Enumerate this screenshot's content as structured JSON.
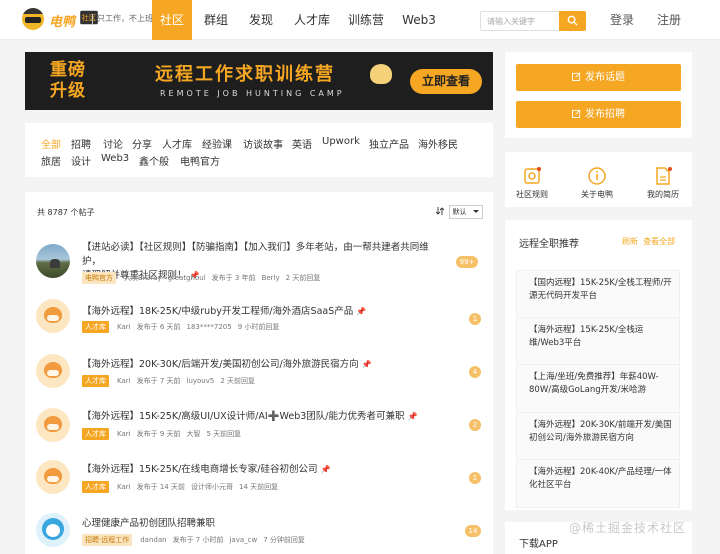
{
  "brand": {
    "name": "电鸭",
    "tag": "社区",
    "slogan": "只工作，不上班"
  },
  "nav": [
    {
      "label": "社区",
      "active": true
    },
    {
      "label": "群组",
      "active": false
    },
    {
      "label": "发现",
      "active": false
    },
    {
      "label": "人才库",
      "active": false
    },
    {
      "label": "训练营",
      "active": false
    },
    {
      "label": "Web3",
      "active": false
    }
  ],
  "search": {
    "placeholder": "请输入关键字"
  },
  "auth": {
    "login": "登录",
    "register": "注册"
  },
  "banner": {
    "left_line1": "重磅",
    "left_line2": "升级",
    "title": "远程工作求职训练营",
    "subtitle": "REMOTE JOB HUNTING CAMP",
    "cta": "立即查看"
  },
  "tags": [
    "全部",
    "招聘",
    "讨论",
    "分享",
    "人才库",
    "经验课",
    "访谈故事",
    "英语",
    "Upwork",
    "独立产品",
    "海外移民",
    "旅居",
    "设计",
    "Web3",
    "鑫个般",
    "电鸭官方"
  ],
  "posts_header": {
    "count": "共 8787 个帖子",
    "sort_label": "默认"
  },
  "posts": [
    {
      "title_line1": "【进站必读】【社区规则】【防骗指南】【加入我们】多年老站，由一帮共建者共同维护，",
      "title_line2": "请理解并尊重社区规则！",
      "badge": "电鸭官方",
      "author": "大灰BIGray",
      "mid": "greatghoul",
      "posted": "发布于 3 年前",
      "last_user": "Berly",
      "last_time": "2 天前回复",
      "count": "99+"
    },
    {
      "title_line1": "【海外远程】18K-25K/中级ruby开发工程师/海外酒店SaaS产品",
      "badge": "人才库",
      "author": "Kari",
      "posted": "发布于 6 天前",
      "last_user": "183****7205",
      "last_time": "9 小时前回复",
      "count": "1"
    },
    {
      "title_line1": "【海外远程】20K-30K/后端开发/美国初创公司/海外旅游民宿方向",
      "badge": "人才库",
      "author": "Kari",
      "posted": "发布于 7 天前",
      "last_user": "luyouv5",
      "last_time": "2 天前回复",
      "count": "4"
    },
    {
      "title_line1": "【海外远程】15K-25K/高级UI/UX设计师/AI➕Web3团队/能力优秀者可兼职",
      "badge": "人才库",
      "author": "Kari",
      "posted": "发布于 9 天前",
      "last_user": "大智",
      "last_time": "5 天前回复",
      "count": "2"
    },
    {
      "title_line1": "【海外远程】15K-25K/在线电商增长专家/硅谷初创公司",
      "badge": "人才库",
      "author": "Kari",
      "posted": "发布于 14 天前",
      "last_user": "设计师小元哥",
      "last_time": "14 天前回复",
      "count": "1"
    },
    {
      "title_line1": "心理健康产品初创团队招聘兼职",
      "badge": "招聘·远程工作",
      "author": "dandan",
      "posted": "发布于 7 小时前",
      "last_user": "java_cw",
      "last_time": "7 分钟前回复",
      "count": "14"
    }
  ],
  "sidebar": {
    "post_topic": "发布话题",
    "post_job": "发布招聘",
    "icons": [
      {
        "label": "社区规则",
        "icon": "gear-icon"
      },
      {
        "label": "关于电鸭",
        "icon": "info-icon"
      },
      {
        "label": "我的简历",
        "icon": "document-icon"
      }
    ],
    "rec_title": "远程全职推荐",
    "rec_refresh": "刷新",
    "rec_all": "查看全部",
    "rec_items": [
      "【国内远程】15K-25K/全栈工程师/开源无代码开发平台",
      "【海外远程】15K-25K/全栈运维/Web3平台",
      "【上海/坐班/免费推荐】年薪40W-80W/高级GoLang开发/米哈游",
      "【海外远程】20K-30K/前端开发/美国初创公司/海外旅游民宿方向",
      "【海外远程】20K-40K/产品经理/一体化社区平台"
    ],
    "download": "下载APP"
  },
  "watermark": "@稀土掘金技术社区",
  "colors": {
    "accent": "#f5a623",
    "banner_bg": "#1e1e1e"
  }
}
